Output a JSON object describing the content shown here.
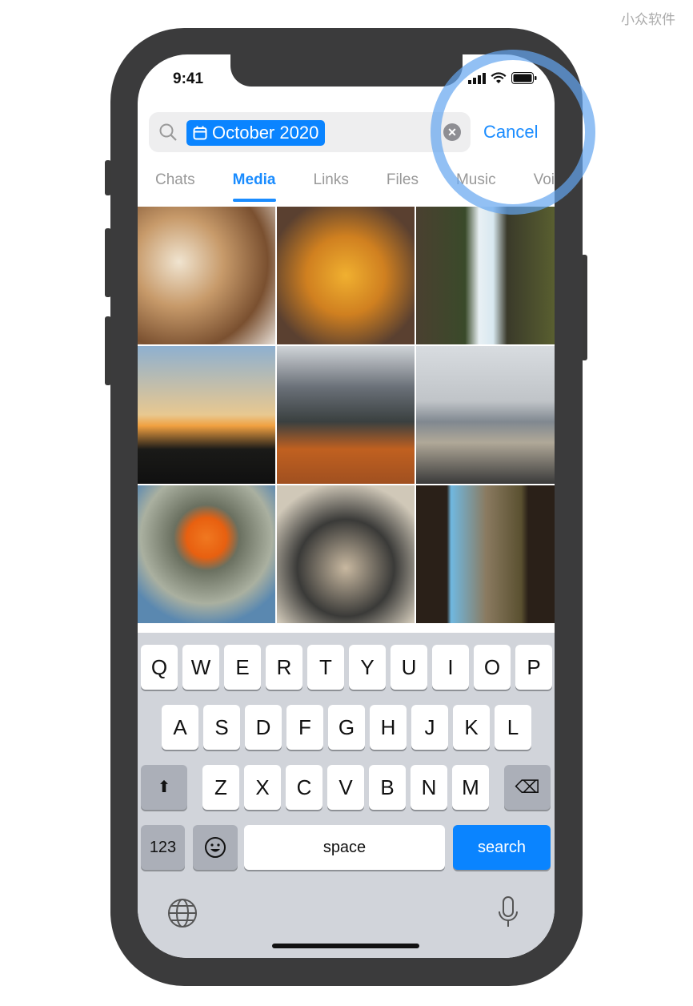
{
  "watermark": "小众软件",
  "status": {
    "time": "9:41",
    "icons": [
      "signal-icon",
      "wifi-icon",
      "battery-icon"
    ]
  },
  "search": {
    "token": "October 2020",
    "token_icon": "calendar-icon",
    "cancel": "Cancel"
  },
  "tabs": [
    {
      "label": "Chats"
    },
    {
      "label": "Media",
      "active": true
    },
    {
      "label": "Links"
    },
    {
      "label": "Files"
    },
    {
      "label": "Music"
    },
    {
      "label": "Voice"
    }
  ],
  "media": [
    "pastries",
    "autumn leaves",
    "waterfall",
    "sunset",
    "mountains autumn",
    "airport",
    "pumpkin person",
    "pinecones",
    "canyon"
  ],
  "keyboard": {
    "row1": [
      "Q",
      "W",
      "E",
      "R",
      "T",
      "Y",
      "U",
      "I",
      "O",
      "P"
    ],
    "row2": [
      "A",
      "S",
      "D",
      "F",
      "G",
      "H",
      "J",
      "K",
      "L"
    ],
    "row3": [
      "Z",
      "X",
      "C",
      "V",
      "B",
      "N",
      "M"
    ],
    "numbers": "123",
    "space": "space",
    "search": "search"
  },
  "colors": {
    "accent": "#0a84ff",
    "highlight_ring": "#64a5f0"
  }
}
